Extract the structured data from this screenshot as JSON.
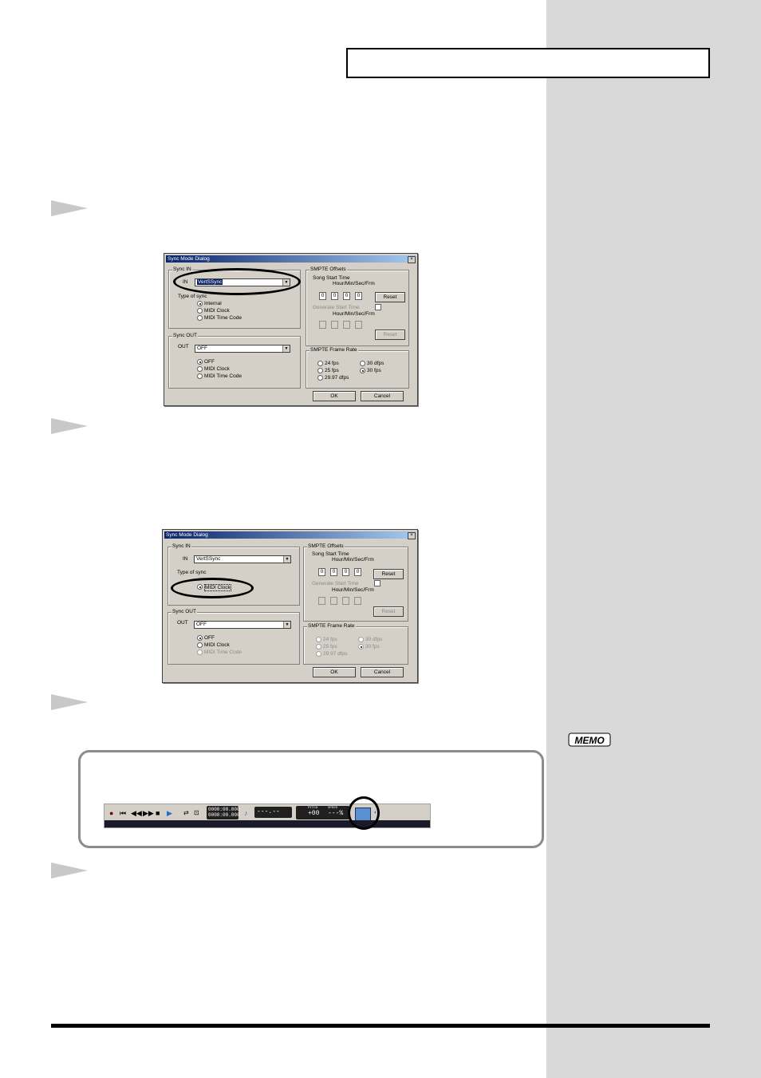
{
  "header": {
    "title": ""
  },
  "dialog1": {
    "title": "Sync Mode Dialog",
    "sync_in": {
      "label": "Sync IN",
      "in_label": "IN",
      "in_value": "VertSSync",
      "type_label": "Type of sync",
      "options": [
        "Internal",
        "MIDI Clock",
        "MIDI Time Code"
      ],
      "selected": 0
    },
    "sync_out": {
      "label": "Sync OUT",
      "out_label": "OUT",
      "out_value": "OFF",
      "options": [
        "OFF",
        "MIDI Clock",
        "MIDI Time Code"
      ],
      "selected": 0
    },
    "smpte_offsets": {
      "label": "SMPTE Offsets",
      "song_start": "Song Start Time",
      "hmsf": "Hour/Min/Sec/Frm",
      "values": [
        "0",
        "0",
        "0",
        "0"
      ],
      "reset": "Reset",
      "generate": "Generate Start Time",
      "hmsf2": "Hour/Min/Sec/Frm",
      "reset2": "Reset"
    },
    "frame_rate": {
      "label": "SMPTE Frame Rate",
      "options": [
        "24 fps",
        "25 fps",
        "29.97 dfps",
        "30 dfps",
        "30 fps"
      ],
      "selected": 4
    },
    "ok": "OK",
    "cancel": "Cancel"
  },
  "dialog2": {
    "title": "Sync Mode Dialog",
    "sync_in": {
      "label": "Sync IN",
      "in_label": "IN",
      "in_value": "VertSSync",
      "type_label": "Type of sync",
      "options": [
        "MIDI Clock"
      ],
      "selected": 0
    },
    "sync_out": {
      "label": "Sync OUT",
      "out_label": "OUT",
      "out_value": "OFF",
      "options": [
        "OFF",
        "MIDI Clock",
        "MIDI Time Code"
      ],
      "selected": 0
    },
    "smpte_offsets": {
      "label": "SMPTE Offsets",
      "song_start": "Song Start Time",
      "hmsf": "Hour/Min/Sec/Frm",
      "values": [
        "0",
        "0",
        "0",
        "0"
      ],
      "reset": "Reset",
      "generate": "Generate Start Time",
      "hmsf2": "Hour/Min/Sec/Frm",
      "reset2": "Reset"
    },
    "frame_rate": {
      "label": "SMPTE Frame Rate",
      "options": [
        "24 fps",
        "25 fps",
        "29.97 dfps",
        "30 dfps",
        "30 fps"
      ],
      "selected": 4
    },
    "ok": "OK",
    "cancel": "Cancel"
  },
  "toolbar": {
    "counter_top": "0000:00.000",
    "counter_bottom": "0000:00.000",
    "tempo_display": "---.--",
    "pitch_label": "PITCH",
    "pitch_value": "+00",
    "speed_label": "SPEED",
    "speed_value": "---%"
  },
  "memo_label": "MEMO"
}
